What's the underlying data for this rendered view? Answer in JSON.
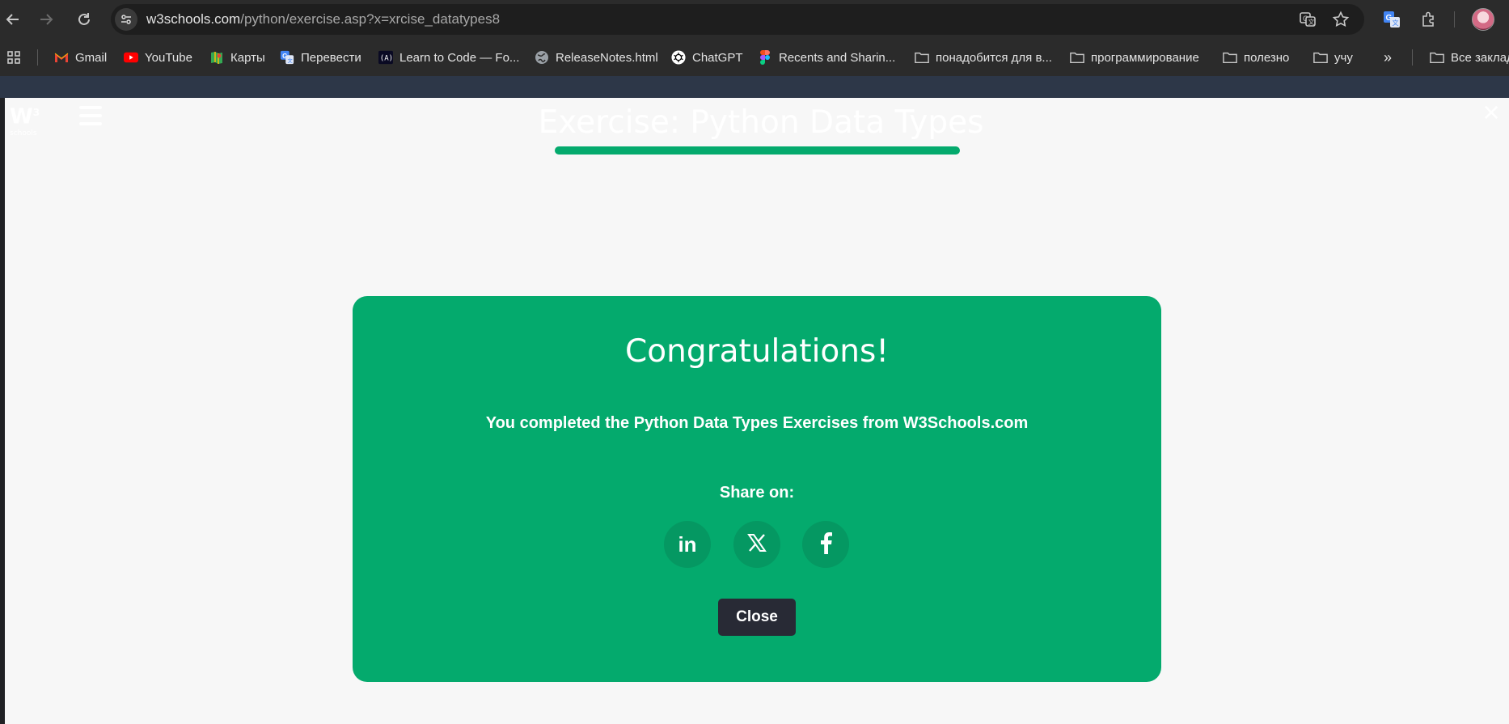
{
  "browser": {
    "url_host": "w3schools.com",
    "url_path": "/python/exercise.asp?x=xrcise_datatypes8",
    "icons": [
      "back-icon",
      "forward-icon",
      "reload-icon",
      "site-info-icon",
      "translate-icon",
      "star-icon",
      "google-translate-icon",
      "extensions-icon",
      "profile-avatar"
    ]
  },
  "bookmarks": {
    "items": [
      {
        "label": "Gmail",
        "icon": "gmail-icon"
      },
      {
        "label": "YouTube",
        "icon": "youtube-icon"
      },
      {
        "label": "Карты",
        "icon": "maps-icon"
      },
      {
        "label": "Перевести",
        "icon": "translate-icon"
      },
      {
        "label": "Learn to Code — Fo...",
        "icon": "freecodecamp-icon"
      },
      {
        "label": "ReleaseNotes.html",
        "icon": "globe-icon"
      },
      {
        "label": "ChatGPT",
        "icon": "chatgpt-icon"
      },
      {
        "label": "Recents and Sharin...",
        "icon": "figma-icon"
      },
      {
        "label": "понадобится для в...",
        "icon": "folder-icon"
      },
      {
        "label": "программирование",
        "icon": "folder-icon"
      },
      {
        "label": "полезно",
        "icon": "folder-icon"
      },
      {
        "label": "учу",
        "icon": "folder-icon"
      }
    ],
    "more": "»",
    "all_bookmarks": "Все заклад"
  },
  "page": {
    "title": "Exercise: Python Data Types",
    "progress_fraction": 1.0,
    "accent_color": "#04aa6d"
  },
  "modal": {
    "title": "Congratulations!",
    "message": "You completed the Python Data Types Exercises from W3Schools.com",
    "share_label": "Share on:",
    "share": [
      "linkedin-icon",
      "x-icon",
      "facebook-icon"
    ],
    "share_text": {
      "linkedin": "in"
    },
    "close_label": "Close",
    "background_color": "#04aa6d",
    "button_color": "#282a35"
  }
}
